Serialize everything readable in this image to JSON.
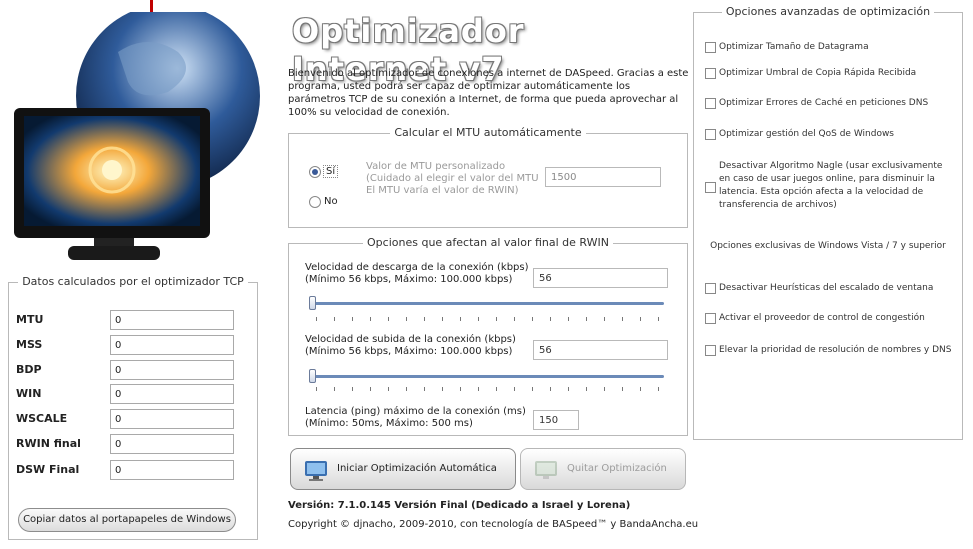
{
  "app": {
    "title": "Optimizador Internet v7",
    "intro": "Bienvenido al optimizador de conexiones a internet de DASpeed. Gracias a este programa, usted podrá ser capaz de optimizar automáticamente los parámetros TCP de su conexión a Internet, de forma que pueda aprovechar al 100% su velocidad de conexión."
  },
  "tcp_panel": {
    "legend": "Datos calculados por el optimizador TCP",
    "rows": [
      {
        "label": "MTU",
        "value": "0"
      },
      {
        "label": "MSS",
        "value": "0"
      },
      {
        "label": "BDP",
        "value": "0"
      },
      {
        "label": "WIN",
        "value": "0"
      },
      {
        "label": "WSCALE",
        "value": "0"
      },
      {
        "label": "RWIN final",
        "value": "0"
      },
      {
        "label": "DSW Final",
        "value": "0"
      }
    ],
    "copy_button": "Copiar datos al portapapeles de Windows"
  },
  "mtu_panel": {
    "legend": "Calcular el MTU automáticamente",
    "yes_label": "Sí",
    "no_label": "No",
    "selected": "Sí",
    "custom_label": "Valor de MTU personalizado\n(Cuidado al elegir el valor del MTU\nEl MTU varía el valor de RWIN)",
    "custom_value": "1500"
  },
  "rwin_panel": {
    "legend": "Opciones que afectan al valor final de RWIN",
    "download_label": "Velocidad de descarga de la conexión (kbps)\n(Mínimo 56 kbps, Máximo: 100.000 kbps)",
    "download_value": "56",
    "upload_label": "Velocidad de subida de la conexión (kbps)\n(Mínimo 56 kbps, Máximo: 100.000 kbps)",
    "upload_value": "56",
    "latency_label": "Latencia (ping) máximo de la conexión (ms)\n(Mínimo: 50ms, Máximo: 500 ms)",
    "latency_value": "150",
    "download_slider_level": 0.0,
    "upload_slider_level": 0.0
  },
  "actions": {
    "start_button": "Iniciar Optimización Automática",
    "remove_button": "Quitar Optimización"
  },
  "footer": {
    "version": "Versión: 7.1.0.145 Versión Final (Dedicado a Israel y Lorena)",
    "copyright": "Copyright © djnacho, 2009-2010, con tecnología de BASpeed™ y BandaAncha.eu"
  },
  "advanced": {
    "legend": "Opciones avanzadas de optimización",
    "options": [
      {
        "label": "Optimizar Tamaño de Datagrama",
        "checked": false
      },
      {
        "label": "Optimizar Umbral de Copia Rápida Recibida",
        "checked": false
      },
      {
        "label": "Optimizar Errores de Caché en peticiones DNS",
        "checked": false
      },
      {
        "label": "Optimizar gestión del QoS de Windows",
        "checked": false
      },
      {
        "label": "Desactivar Algoritmo Nagle (usar exclusivamente en caso de usar juegos online, para disminuir la latencia. Esta opción afecta a la velocidad de transferencia de archivos)",
        "checked": false
      }
    ],
    "vista_section": "Opciones exclusivas de Windows Vista / 7 y superior",
    "vista_options": [
      {
        "label": "Desactivar Heurísticas del escalado de ventana",
        "checked": false
      },
      {
        "label": "Activar el proveedor de control de congestión",
        "checked": false
      },
      {
        "label": "Elevar la prioridad de resolución de nombres y DNS",
        "checked": false
      }
    ]
  },
  "colors": {
    "accent": "#c00000",
    "slider": "#6b8ab8"
  }
}
